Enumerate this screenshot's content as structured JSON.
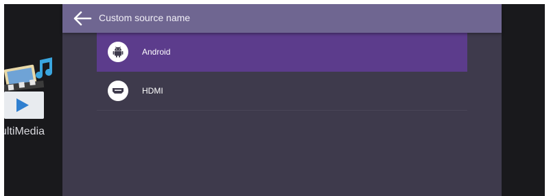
{
  "background_app": {
    "label": "ultiMedia",
    "icon": "multimedia-icon"
  },
  "dialog": {
    "title": "Custom source name",
    "back_icon": "arrow-left-icon",
    "sources": [
      {
        "label": "Android",
        "icon": "android-icon",
        "selected": true
      },
      {
        "label": "HDMI",
        "icon": "hdmi-icon",
        "selected": false
      }
    ]
  },
  "colors": {
    "header": "#6f6691",
    "panel": "#3e3a4c",
    "selected_row": "#5c3c8c",
    "screen_background": "#19191c"
  }
}
